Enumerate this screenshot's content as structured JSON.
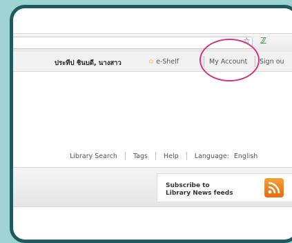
{
  "toolbar": {
    "star_icon": "star-icon",
    "extension_icon": "extension-icon"
  },
  "userbar": {
    "user_name": "ประทีป ชินบดี, นางสาว",
    "eshelf_label": "e-Shelf",
    "my_account_label": "My Account",
    "sign_out_label": "Sign ou"
  },
  "nav": {
    "library_search": "Library Search",
    "tags": "Tags",
    "help": "Help",
    "language_label": "Language:",
    "language_value": "English"
  },
  "rss": {
    "line1": "Subscribe to",
    "line2": "Library News feeds"
  },
  "colors": {
    "frame_border": "#1f5a5e",
    "background": "#9fd3d3",
    "highlight_circle": "#d8327a",
    "rss_orange": "#f08a20"
  }
}
